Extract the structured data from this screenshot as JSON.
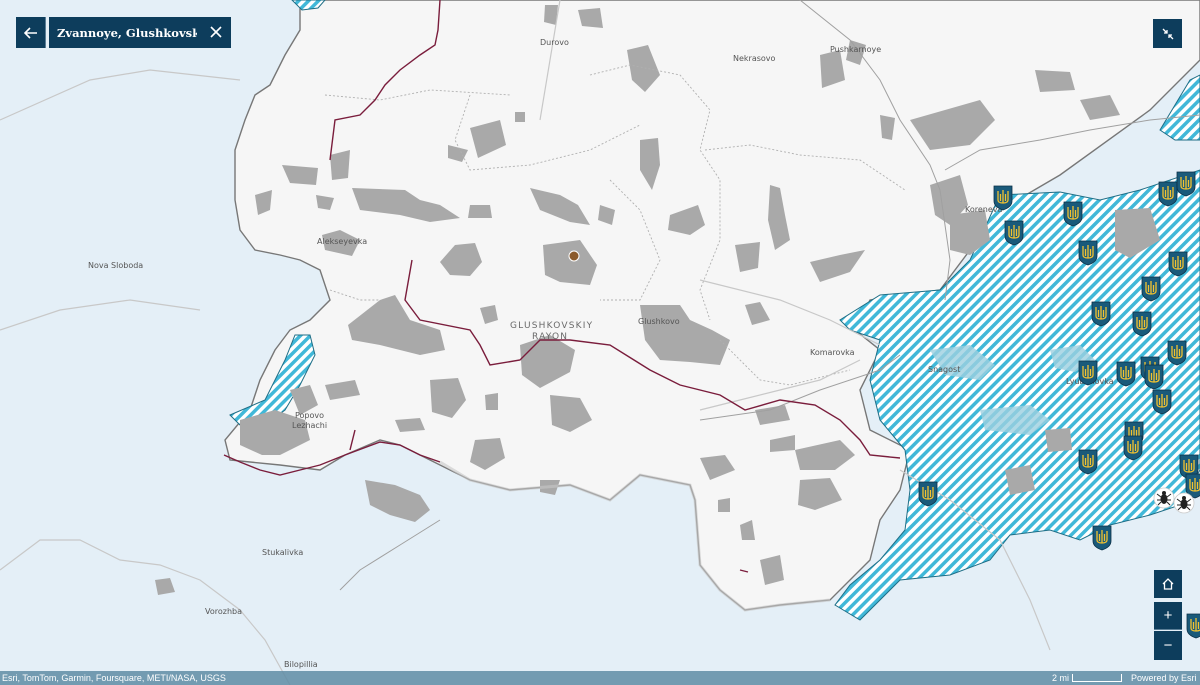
{
  "search": {
    "value": "Zvannoye, Glushkovskiy r"
  },
  "controls": {
    "back_icon": "arrow-left-icon",
    "close_icon": "close-icon",
    "collapse_icon": "collapse-icon",
    "home_icon": "home-icon",
    "zoom_in_label": "+",
    "zoom_out_label": "−"
  },
  "map": {
    "labels": {
      "durovo": "Durovo",
      "pushkarnoye": "Pushkarnoye",
      "nekrasovo": "Nekrasovo",
      "koreneva": "Koreneva",
      "alekseyevka": "Alekseyevka",
      "nova_sloboda": "Nova Sloboda",
      "glushkovskiy": "GLUSHKOVSKIY",
      "rayon": "RAYON",
      "glushkovo": "Glushkovo",
      "komarovka": "Komarovka",
      "snagost": "Snagost",
      "lyubimovka": "Lyubimovka",
      "popovo": "Popovo",
      "lezhachi": "Lezhachi",
      "stukalivka": "Stukalivka",
      "vorozhba": "Vorozhba",
      "bilopillia": "Bilopillia"
    },
    "colors": {
      "land_russia": "#f6f6f6",
      "land_ukraine": "#e4eff7",
      "built_up": "#a9a9a9",
      "control_zone_hatch": "#41b8d8",
      "border_line": "#7a1d3c",
      "marker": "#8b5a2b",
      "controls_bg": "#0d3d5c"
    },
    "markers": {
      "trident_icon": "ukrainian-trident-icon",
      "bug_icon": "insect-icon",
      "location_marker": "location-dot-icon"
    }
  },
  "footer": {
    "attribution": "Esri, TomTom, Garmin, Foursquare, METI/NASA, USGS",
    "scale_label": "2 mi",
    "powered_by": "Powered by Esri"
  }
}
